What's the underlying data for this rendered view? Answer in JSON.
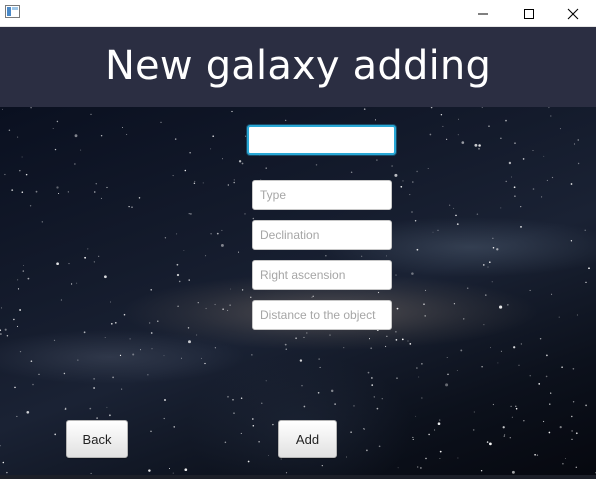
{
  "window": {
    "controls": [
      "minimize-icon",
      "maximize-icon",
      "close-icon"
    ]
  },
  "header": {
    "title": "New galaxy adding"
  },
  "form": {
    "name": {
      "value": "",
      "placeholder": ""
    },
    "type": {
      "value": "",
      "placeholder": "Type"
    },
    "declination": {
      "value": "",
      "placeholder": "Declination"
    },
    "right_ascension": {
      "value": "",
      "placeholder": "Right ascension"
    },
    "distance": {
      "value": "",
      "placeholder": "Distance to the object"
    }
  },
  "buttons": {
    "back": "Back",
    "add": "Add"
  },
  "colors": {
    "header_bg": "#2b2e42",
    "focus_border": "#29a8d6"
  }
}
